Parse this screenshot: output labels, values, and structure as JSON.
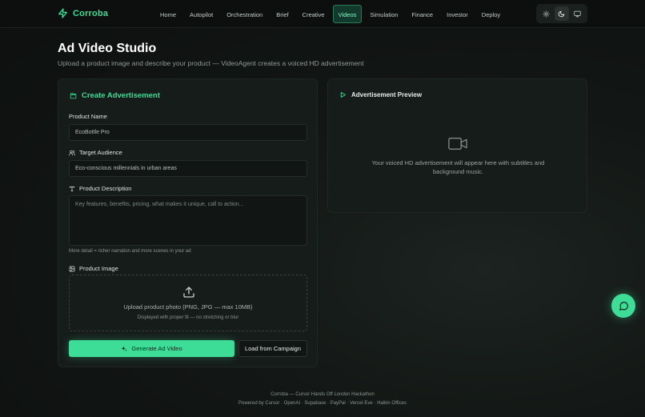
{
  "brand": {
    "name": "Corroba",
    "icon": "zap-icon",
    "color": "#3ddc97"
  },
  "nav": [
    {
      "label": "Home",
      "active": false
    },
    {
      "label": "Autopilot",
      "active": false
    },
    {
      "label": "Orchestration",
      "active": false
    },
    {
      "label": "Brief",
      "active": false
    },
    {
      "label": "Creative",
      "active": false
    },
    {
      "label": "Videos",
      "active": true
    },
    {
      "label": "Simulation",
      "active": false
    },
    {
      "label": "Finance",
      "active": false
    },
    {
      "label": "Investor",
      "active": false
    },
    {
      "label": "Deploy",
      "active": false
    }
  ],
  "theme": {
    "options": [
      "sun-icon",
      "moon-icon",
      "monitor-icon"
    ],
    "selected": "moon-icon"
  },
  "page": {
    "title": "Ad Video Studio",
    "subtitle": "Upload a product image and describe your product — VideoAgent creates a voiced HD advertisement"
  },
  "form": {
    "title": "Create Advertisement",
    "product_name": {
      "label": "Product Name",
      "value": "EcoBottle Pro"
    },
    "target_audience": {
      "label": "Target Audience",
      "value": "Eco-conscious millennials in urban areas"
    },
    "product_description": {
      "label": "Product Description",
      "placeholder": "Key features, benefits, pricing, what makes it unique, call to action...",
      "hint": "More detail = richer narration and more scenes in your ad"
    },
    "product_image": {
      "label": "Product Image",
      "upload_text": "Upload product photo (PNG, JPG — max 10MB)",
      "upload_subtext": "Displayed with proper fit — no stretching or blur"
    },
    "generate_label": "Generate Ad Video",
    "load_label": "Load from Campaign"
  },
  "preview": {
    "title": "Advertisement Preview",
    "empty_text": "Your voiced HD advertisement will appear here with subtitles and background music."
  },
  "footer": {
    "line1": "Corroba — Cursor Hands Off London Hackathon",
    "line2": "Powered by Cursor · OpenAI · Supabase · PayPal · Vercel Eve · Halkin Offices"
  },
  "colors": {
    "accent": "#3ddc97",
    "background": "#121614",
    "card": "#161c1a"
  }
}
